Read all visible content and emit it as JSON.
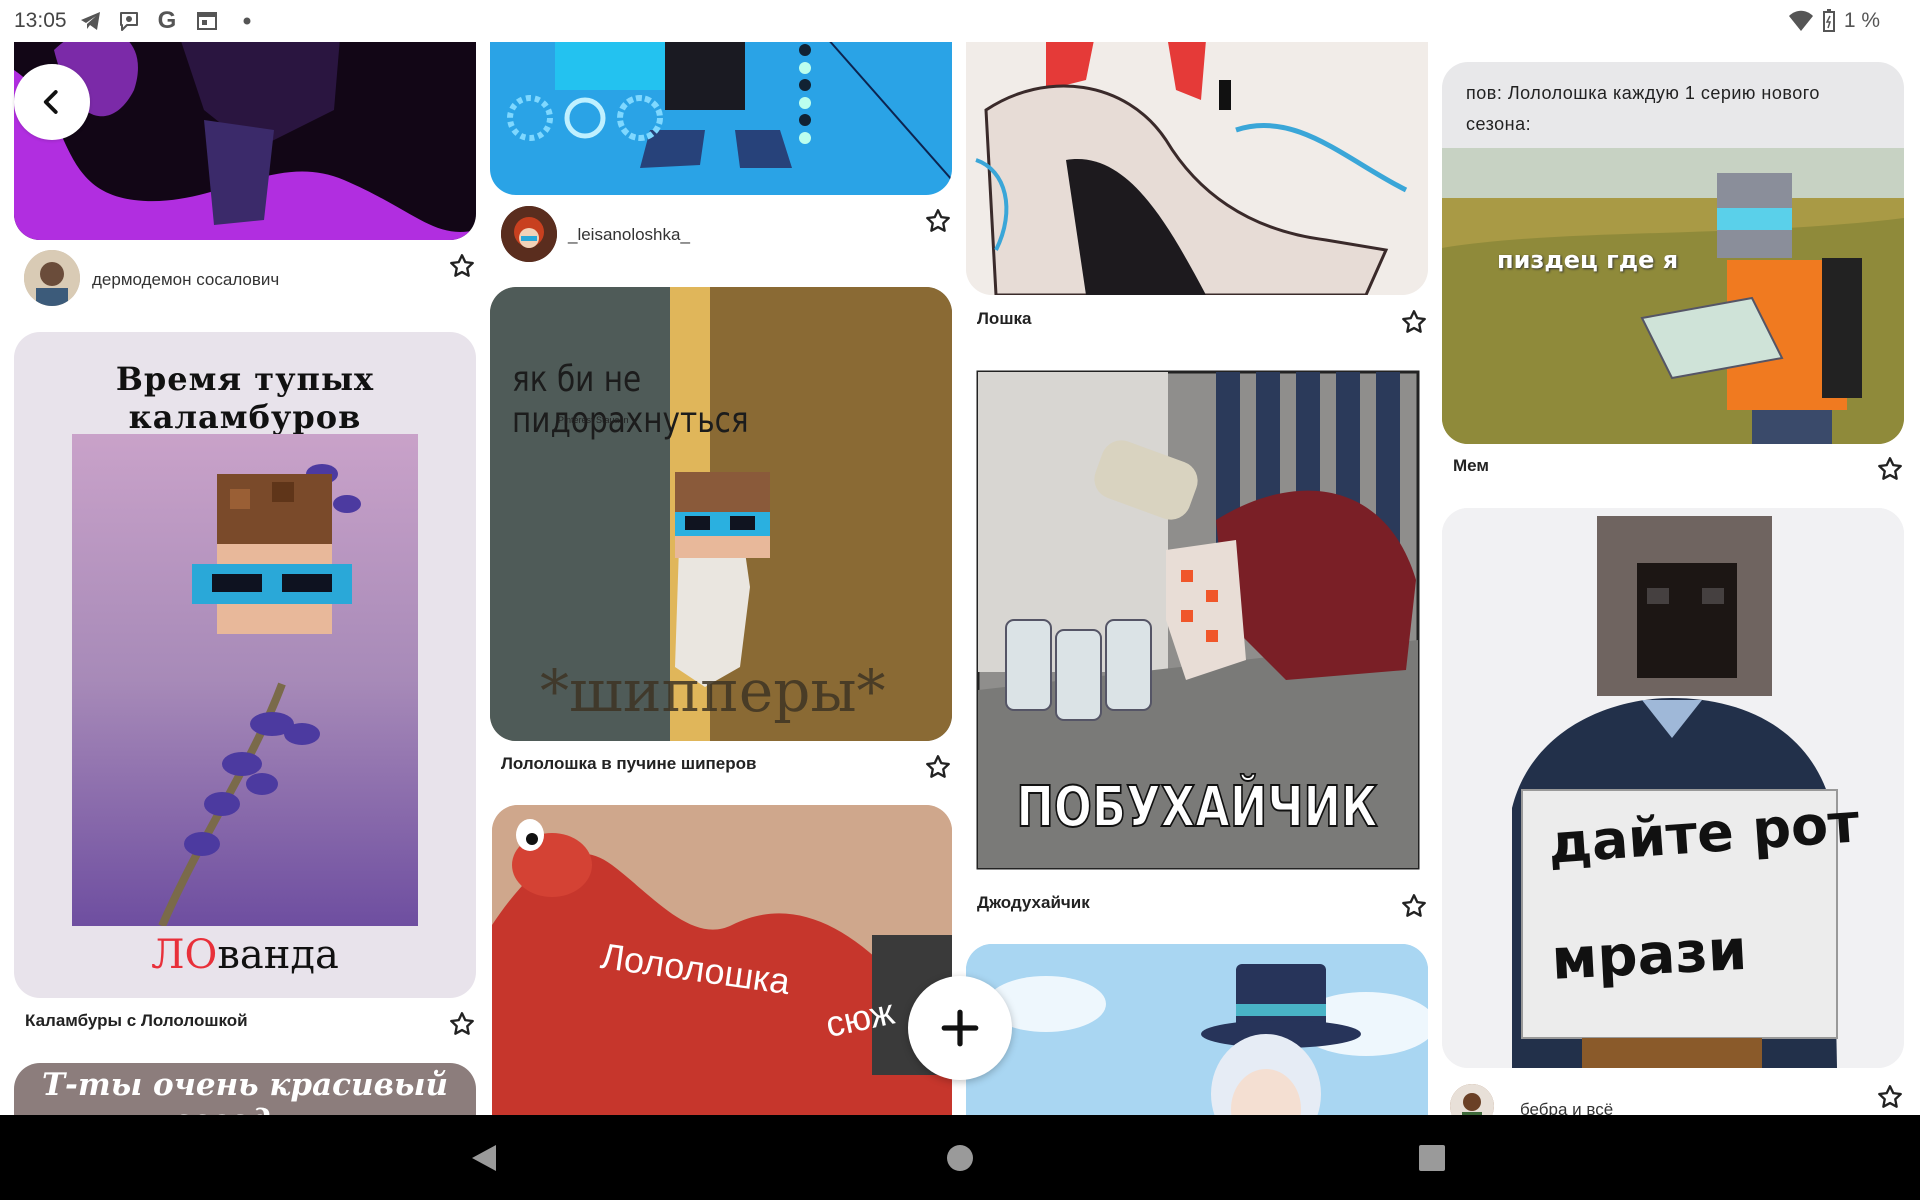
{
  "status_bar": {
    "time": "13:05",
    "battery": "1 %",
    "icons": [
      "telegram-icon",
      "viber-icon",
      "google-icon",
      "calendar-icon",
      "dot-icon"
    ]
  },
  "back_button": {
    "icon": "chevron-left-icon"
  },
  "fab": {
    "icon": "plus-icon"
  },
  "col1": {
    "pin1_author": "дермодемон сосалович",
    "pin2_heading": "Время тупых каламбуров",
    "pin2_caption_red": "ЛО",
    "pin2_caption_rest": "ванда",
    "pin2_title": "Каламбуры с Лололошкой",
    "pin3_text": "Т-ты очень красивый сегодня"
  },
  "col2": {
    "pin1_author": "_leisanoloshka_",
    "pin2_meme_text": "як би не пидорахнуться",
    "pin2_watermark": "Pinterest Staualin",
    "pin2_bottom_text": "*шипперы*",
    "pin2_title": "Лололошка в пучине шиперов",
    "pin3_overlay1": "Лололошка",
    "pin3_overlay2": "сюж"
  },
  "col3": {
    "pin1_title": "Лошка",
    "pin2_caption": "ПОБУХАЙЧИК",
    "pin2_title": "Джодухайчик"
  },
  "col4": {
    "pin1_caption": "пов: Лололошка каждую 1 серию нового сезона:",
    "pin1_overlay": "пиздец где я",
    "pin1_title": "Мем",
    "pin2_sign1": "дайте рот",
    "pin2_sign2": "мрази",
    "pin2_author": "бебра и всё"
  },
  "nav": {
    "back": "back-triangle-icon",
    "home": "home-circle-icon",
    "recents": "recents-square-icon"
  },
  "colors": {
    "accent_red": "#e8303a",
    "card_bg": "#e9e4ea"
  }
}
